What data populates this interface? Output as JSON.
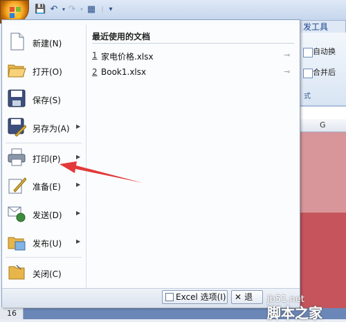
{
  "ribbon": {
    "tab_label": "发工具",
    "items": [
      "自动换",
      "",
      "合并后"
    ],
    "group_label": "式"
  },
  "sheet": {
    "column_header": "G",
    "row_number": "16"
  },
  "menu": {
    "items": [
      {
        "label": "新建(N)",
        "icon": "new-document-icon",
        "submenu": false
      },
      {
        "label": "打开(O)",
        "icon": "open-folder-icon",
        "submenu": false
      },
      {
        "label": "保存(S)",
        "icon": "save-disk-icon",
        "submenu": false
      },
      {
        "label": "另存为(A)",
        "icon": "save-as-icon",
        "submenu": true
      },
      {
        "label": "打印(P)",
        "icon": "printer-icon",
        "submenu": true
      },
      {
        "label": "准备(E)",
        "icon": "prepare-pen-icon",
        "submenu": true
      },
      {
        "label": "发送(D)",
        "icon": "send-icon",
        "submenu": true
      },
      {
        "label": "发布(U)",
        "icon": "publish-icon",
        "submenu": true
      },
      {
        "label": "关闭(C)",
        "icon": "close-folder-icon",
        "submenu": false
      }
    ],
    "recent_title": "最近使用的文档",
    "recent_files": [
      {
        "num": "1",
        "name": "家电价格.xlsx"
      },
      {
        "num": "2",
        "name": "Book1.xlsx"
      }
    ],
    "footer": {
      "options_label": "Excel 选项(I)",
      "exit_label": "退"
    }
  },
  "watermark": {
    "site": "jb51.net",
    "brand": "脚本之家"
  },
  "colors": {
    "accent_arrow": "#e23a3a",
    "menu_border": "#8ea2c0",
    "sheet_fill_light": "#d8969a",
    "sheet_fill_dark": "#c6545c"
  }
}
